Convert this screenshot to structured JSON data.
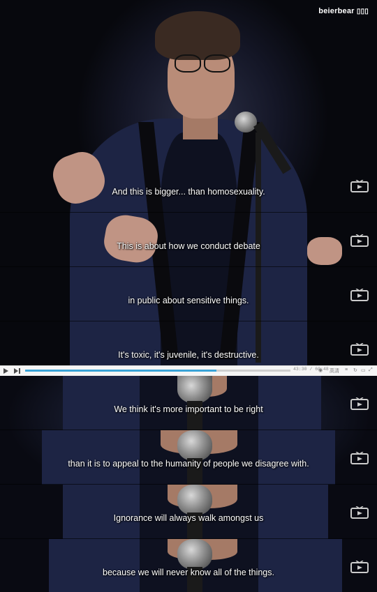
{
  "watermark": {
    "text": "beierbear",
    "logo": "bilibili-logo"
  },
  "subtitles_top": [
    "And this is bigger... than homosexuality.",
    "This is about how we conduct debate",
    "in public about sensitive things.",
    "It's toxic, it's juvenile, it's destructive."
  ],
  "subtitles_bottom": [
    "We think it's more important to be right",
    "than it is to appeal to the humanity of people we disagree with.",
    "Ignorance will always walk amongst us",
    "because we will never know all of the things."
  ],
  "player": {
    "time": "43:30 / 60:48",
    "progress": 0.72,
    "quality_label": "高清",
    "icons": [
      "play-icon",
      "next-icon",
      "danmaku-icon",
      "quality-icon",
      "settings-icon",
      "fullscreen-icon"
    ]
  },
  "colors": {
    "progress": "#3aa4d8",
    "jacket": "#1d2444",
    "background": "#0b0c14"
  }
}
